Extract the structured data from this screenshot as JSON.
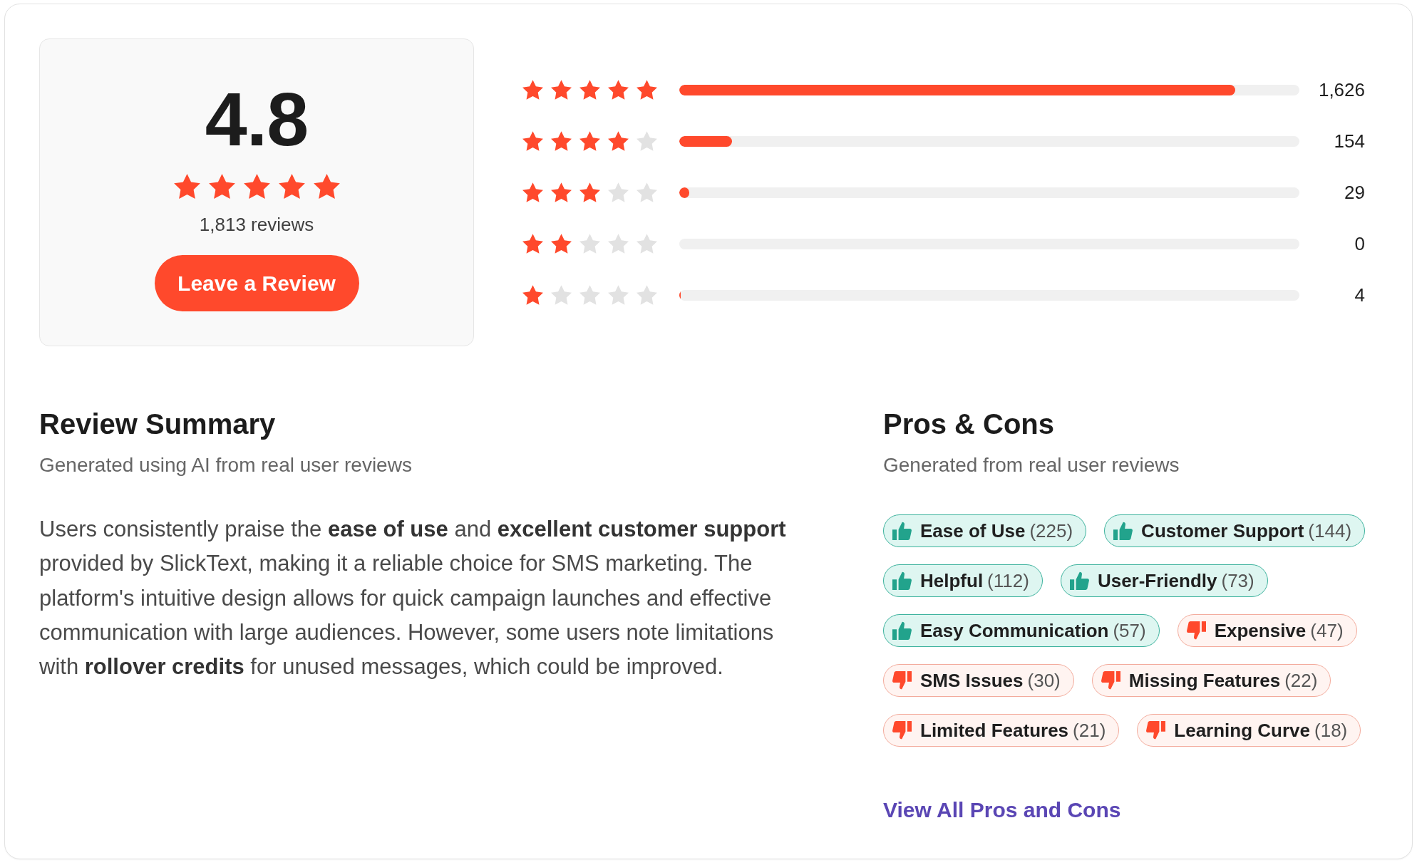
{
  "rating_card": {
    "score": "4.8",
    "stars": 5,
    "review_count": "1,813 reviews",
    "button": "Leave a Review"
  },
  "rating_breakdown": [
    {
      "stars": 5,
      "level": 0.897,
      "count": "1,626"
    },
    {
      "stars": 4,
      "level": 0.085,
      "count": "154"
    },
    {
      "stars": 3,
      "level": 0.016,
      "count": "29"
    },
    {
      "stars": 2,
      "count": "0"
    },
    {
      "stars": 1,
      "level": 0.002,
      "count": "4"
    }
  ],
  "review_summary": {
    "title": "Review Summary",
    "subtitle": "Generated using AI from real user reviews",
    "text": "Users consistently praise the **ease of use** and **excellent customer support** provided by SlickText, making it a reliable choice for SMS marketing. The platform's intuitive design allows for quick campaign launches and effective communication with large audiences. However, some users note limitations with **rollover credits** for unused messages, which could be improved."
  },
  "pros_cons": {
    "title": "Pros & Cons",
    "subtitle": "Generated from real user reviews",
    "tags": [
      {
        "kind": "pro",
        "label": "Ease of Use",
        "count": "(225)"
      },
      {
        "kind": "pro",
        "label": "Customer Support",
        "count": "(144)"
      },
      {
        "kind": "pro",
        "label": "Helpful",
        "count": "(112)"
      },
      {
        "kind": "pro",
        "label": "User-Friendly",
        "count": "(73)"
      },
      {
        "kind": "pro",
        "label": "Easy Communication",
        "count": "(57)"
      },
      {
        "kind": "con",
        "label": "Expensive",
        "count": "(47)"
      },
      {
        "kind": "con",
        "label": "SMS Issues",
        "count": "(30)"
      },
      {
        "kind": "con",
        "label": "Missing Features",
        "count": "(22)"
      },
      {
        "kind": "con",
        "label": "Limited Features",
        "count": "(21)"
      },
      {
        "kind": "con",
        "label": "Learning Curve",
        "count": "(18)"
      }
    ],
    "link": "View All Pros and Cons"
  }
}
